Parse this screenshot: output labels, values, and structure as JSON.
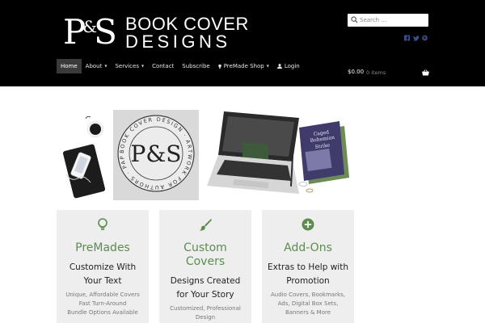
{
  "header": {
    "logo": {
      "monogram_left": "P",
      "monogram_amp": "&",
      "monogram_right": "S",
      "line1": "BOOK COVER",
      "line2": "DESIGNS"
    },
    "search": {
      "placeholder": "Search …",
      "icon": "search-icon"
    },
    "social": [
      "facebook-icon",
      "twitter-icon",
      "pinterest-icon"
    ],
    "social_color": "#3b4e8a",
    "nav": [
      {
        "label": "Home",
        "active": true,
        "dropdown": false
      },
      {
        "label": "About",
        "dropdown": true
      },
      {
        "label": "Services",
        "dropdown": true
      },
      {
        "label": "Contact",
        "dropdown": false
      },
      {
        "label": "Subscribe",
        "dropdown": false
      },
      {
        "label": "PreMade Shop",
        "dropdown": true,
        "icon": "lightbulb-icon"
      },
      {
        "label": "Login",
        "dropdown": false,
        "icon": "user-icon"
      }
    ],
    "cart": {
      "amount": "$0.00",
      "items": "0 items",
      "icon": "basket-icon"
    }
  },
  "hero": {
    "badge_ring_text": "BOOK COVER DESIGN · ARTWORK FOR AUTHORS · PAPER & SAGE",
    "badge_monogram": "P&S",
    "book_title_line1": "Caged",
    "book_title_line2": "Bohemian",
    "book_title_line3": "Strike"
  },
  "accent_color": "#5c8c4e",
  "cards": [
    {
      "icon": "lightbulb-icon",
      "title": "PreMades",
      "subtitle_line1": "Customize With",
      "subtitle_line2": "Your Text",
      "desc": [
        "Unique, Affordable Covers",
        "Fast Turn-Around",
        "Bundle Options Available"
      ]
    },
    {
      "icon": "paintbrush-icon",
      "title_line1": "Custom",
      "title_line2": "Covers",
      "subtitle_line1": "Designs Created",
      "subtitle_line2": "for Your Story",
      "desc": [
        "Customized, Professional",
        "Design"
      ]
    },
    {
      "icon": "plus-circle-icon",
      "title": "Add-Ons",
      "subtitle_line1": "Extras to Help with",
      "subtitle_line2": "Promotion",
      "desc": [
        "Audio Covers, Bookmarks,",
        "Ads, Digital Box Sets,",
        "Banners & More"
      ]
    }
  ]
}
